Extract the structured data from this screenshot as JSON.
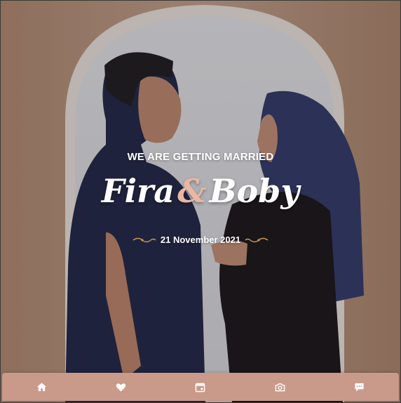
{
  "hero": {
    "tagline": "WE ARE GETTING MARRIED",
    "name_one": "Fira",
    "ampersand": "&",
    "name_two": "Boby",
    "date": "21 November 2021"
  },
  "colors": {
    "accent": "#e9b7a4",
    "nav_bg": "#c9998a",
    "text": "#ffffff",
    "flourish": "#c79a5a"
  },
  "navbar": {
    "items": [
      {
        "icon": "home-icon"
      },
      {
        "icon": "heart-icon"
      },
      {
        "icon": "calendar-icon"
      },
      {
        "icon": "camera-icon"
      },
      {
        "icon": "message-icon"
      }
    ]
  }
}
